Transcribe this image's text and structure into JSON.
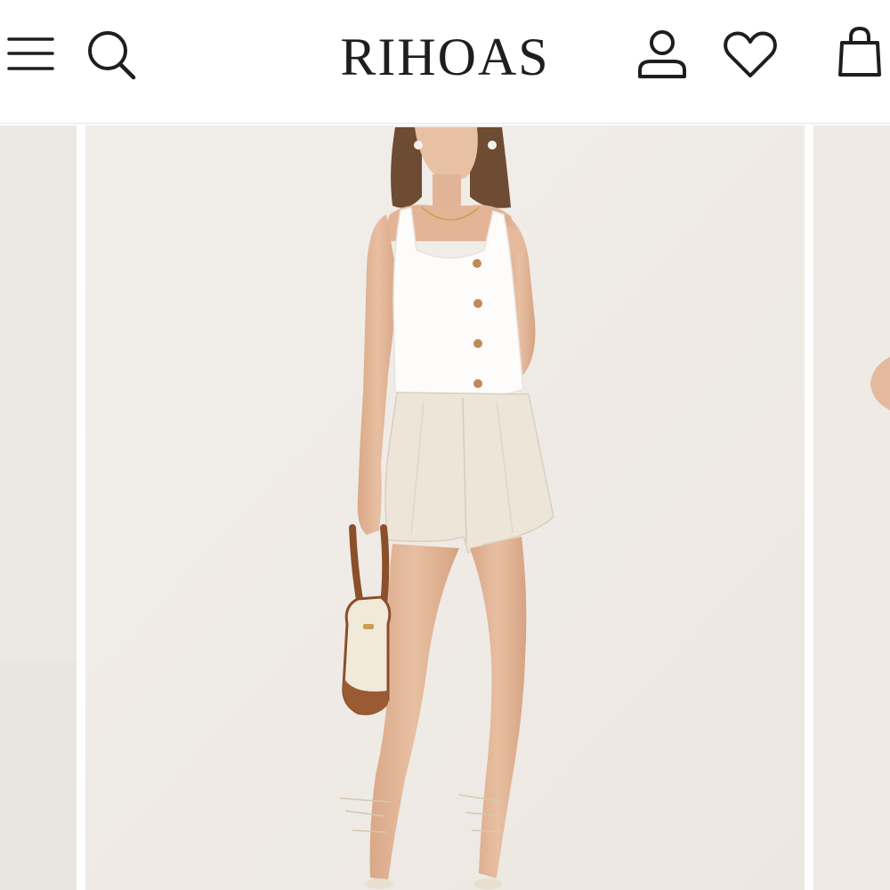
{
  "header": {
    "logo_text": "RIHOAS",
    "icons": [
      "menu-icon",
      "search-icon",
      "account-icon",
      "wishlist-icon",
      "cart-icon"
    ]
  },
  "colors": {
    "icon": "#1e1e1e",
    "background": "#f1eeea",
    "top": "#ffffff",
    "shorts": "#ece5d8",
    "bag_brown": "#8b4f2c"
  }
}
